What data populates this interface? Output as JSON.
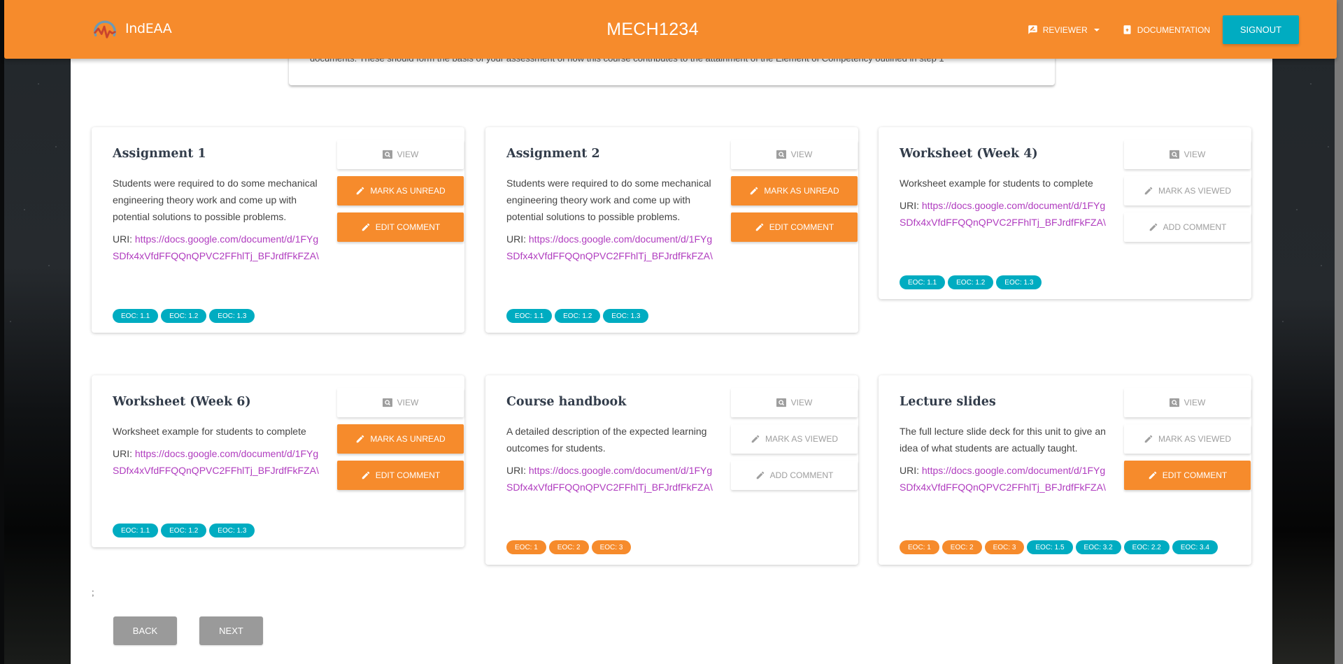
{
  "navbar": {
    "brand": "IndEAA",
    "course_code": "MECH1234",
    "reviewer_label": "REVIEWER",
    "documentation_label": "DOCUMENTATION",
    "signout_label": "SIGNOUT"
  },
  "instruction": {
    "text": "documents. These should form the basis of your assessment of how this course contributes to the attainment of the Element of Competency outlined in step 1"
  },
  "uri_label": "URI:",
  "cards": [
    {
      "title": "Assignment 1",
      "description": "Students were required to do some mechanical engineering theory work and come up with potential solutions to possible problems.",
      "uri": "https://docs.google.com/document/d/1FYgSDfx4xVfdFFQQnQPVC2FFhlTj_BFJrdfFkFZA\\",
      "buttons": [
        "VIEW",
        "MARK AS UNREAD",
        "EDIT COMMENT"
      ],
      "tags": [
        {
          "label": "EOC: 1.1",
          "color": "teal"
        },
        {
          "label": "EOC: 1.2",
          "color": "teal"
        },
        {
          "label": "EOC: 1.3",
          "color": "teal"
        }
      ]
    },
    {
      "title": "Assignment 2",
      "description": "Students were required to do some mechanical engineering theory work and come up with potential solutions to possible problems.",
      "uri": "https://docs.google.com/document/d/1FYgSDfx4xVfdFFQQnQPVC2FFhlTj_BFJrdfFkFZA\\",
      "buttons": [
        "VIEW",
        "MARK AS UNREAD",
        "EDIT COMMENT"
      ],
      "tags": [
        {
          "label": "EOC: 1.1",
          "color": "teal"
        },
        {
          "label": "EOC: 1.2",
          "color": "teal"
        },
        {
          "label": "EOC: 1.3",
          "color": "teal"
        }
      ]
    },
    {
      "title": "Worksheet (Week 4)",
      "description": "Worksheet example for students to complete",
      "uri": "https://docs.google.com/document/d/1FYgSDfx4xVfdFFQQnQPVC2FFhlTj_BFJrdfFkFZA\\",
      "buttons": [
        "VIEW",
        "MARK AS VIEWED",
        "ADD COMMENT"
      ],
      "tags": [
        {
          "label": "EOC: 1.1",
          "color": "teal"
        },
        {
          "label": "EOC: 1.2",
          "color": "teal"
        },
        {
          "label": "EOC: 1.3",
          "color": "teal"
        }
      ]
    },
    {
      "title": "Worksheet (Week 6)",
      "description": "Worksheet example for students to complete",
      "uri": "https://docs.google.com/document/d/1FYgSDfx4xVfdFFQQnQPVC2FFhlTj_BFJrdfFkFZA\\",
      "buttons": [
        "VIEW",
        "MARK AS UNREAD",
        "EDIT COMMENT"
      ],
      "tags": [
        {
          "label": "EOC: 1.1",
          "color": "teal"
        },
        {
          "label": "EOC: 1.2",
          "color": "teal"
        },
        {
          "label": "EOC: 1.3",
          "color": "teal"
        }
      ]
    },
    {
      "title": "Course handbook",
      "description": "A detailed description of the expected learning outcomes for students.",
      "uri": "https://docs.google.com/document/d/1FYgSDfx4xVfdFFQQnQPVC2FFhlTj_BFJrdfFkFZA\\",
      "buttons": [
        "VIEW",
        "MARK AS VIEWED",
        "ADD COMMENT"
      ],
      "tags": [
        {
          "label": "EOC: 1",
          "color": "orange"
        },
        {
          "label": "EOC: 2",
          "color": "orange"
        },
        {
          "label": "EOC: 3",
          "color": "orange"
        }
      ]
    },
    {
      "title": "Lecture slides",
      "description": "The full lecture slide deck for this unit to give an idea of what students are actually taught.",
      "uri": "https://docs.google.com/document/d/1FYgSDfx4xVfdFFQQnQPVC2FFhlTj_BFJrdfFkFZA\\",
      "buttons": [
        "VIEW",
        "MARK AS VIEWED",
        "EDIT COMMENT"
      ],
      "tags": [
        {
          "label": "EOC: 1",
          "color": "orange"
        },
        {
          "label": "EOC: 2",
          "color": "orange"
        },
        {
          "label": "EOC: 3",
          "color": "orange"
        },
        {
          "label": "EOC: 1.5",
          "color": "teal"
        },
        {
          "label": "EOC: 3.2",
          "color": "teal"
        },
        {
          "label": "EOC: 2.2",
          "color": "teal"
        },
        {
          "label": "EOC: 3.4",
          "color": "teal"
        }
      ]
    }
  ],
  "footer": {
    "stray_text": ";",
    "back_label": "BACK",
    "next_label": "NEXT"
  },
  "colors": {
    "primary": "#f68b2c",
    "accent": "#00acc1",
    "link": "#b03cbf"
  }
}
